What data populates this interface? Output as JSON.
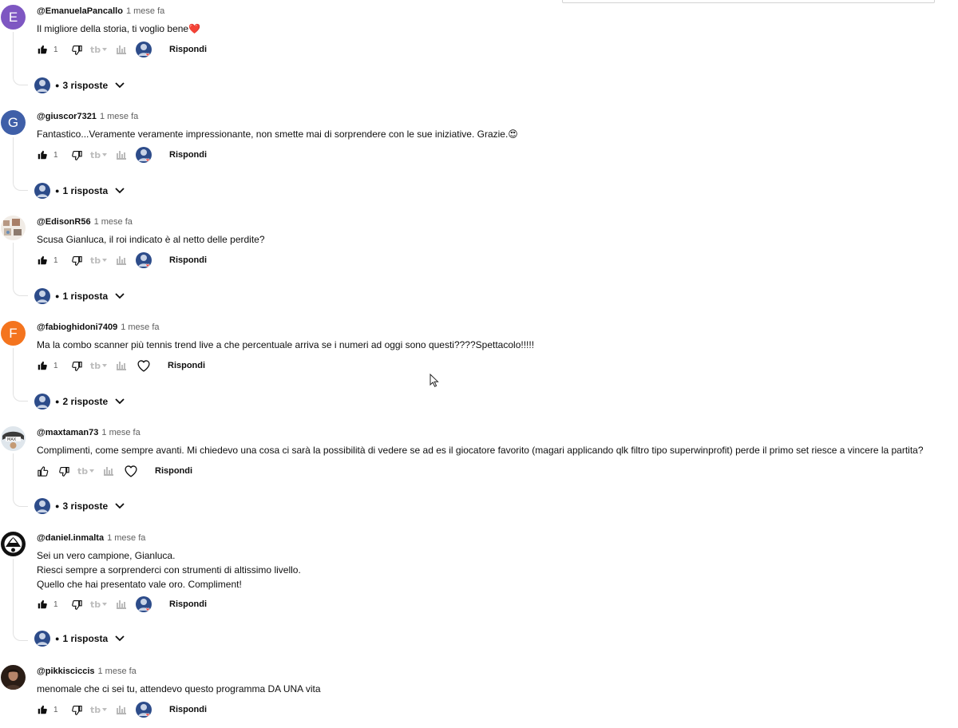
{
  "colors": {
    "avatar_e": "#7e57c2",
    "avatar_g": "#3f5fa8",
    "avatar_f": "#f4741e",
    "reply_link": "#0f0f0f",
    "meta": "#606060"
  },
  "comments": [
    {
      "author": "@EmanuelaPancallo",
      "time": "1 mese fa",
      "avatar_letter": "E",
      "lines": [
        "Il migliore della storia, ti voglio bene❤️"
      ],
      "likes": "1",
      "reply_label": "Rispondi",
      "replies_label": "3 risposte"
    },
    {
      "author": "@giuscor7321",
      "time": "1 mese fa",
      "avatar_letter": "G",
      "lines": [
        "Fantastico...Veramente veramente impressionante, non smette mai di sorprendere con le sue iniziative. Grazie.😍"
      ],
      "likes": "1",
      "reply_label": "Rispondi",
      "replies_label": "1 risposta"
    },
    {
      "author": "@EdisonR56",
      "time": "1 mese fa",
      "lines": [
        "Scusa Gianluca, il roi indicato è al netto delle perdite?"
      ],
      "likes": "1",
      "reply_label": "Rispondi",
      "replies_label": "1 risposta"
    },
    {
      "author": "@fabioghidoni7409",
      "time": "1 mese fa",
      "avatar_letter": "F",
      "lines": [
        "Ma  la combo scanner più tennis trend live a che percentuale arriva se i numeri ad oggi sono questi????Spettacolo!!!!!"
      ],
      "likes": "1",
      "reply_label": "Rispondi",
      "replies_label": "2 risposte"
    },
    {
      "author": "@maxtaman73",
      "time": "1 mese fa",
      "lines": [
        "Complimenti, come sempre avanti. Mi chiedevo una cosa ci sarà la possibilità di vedere se ad es il giocatore favorito (magari applicando qlk filtro tipo  superwinprofit) perde il primo set riesce a vincere la partita?"
      ],
      "likes": "",
      "reply_label": "Rispondi",
      "replies_label": "3 risposte"
    },
    {
      "author": "@daniel.inmalta",
      "time": "1 mese fa",
      "lines": [
        "Sei un vero campione, Gianluca.",
        "Riesci sempre a sorprenderci con strumenti di altissimo livello.",
        "Quello che hai presentato vale oro. Compliment!"
      ],
      "likes": "1",
      "reply_label": "Rispondi",
      "replies_label": "1 risposta"
    },
    {
      "author": "@pikkisciccis",
      "time": "1 mese fa",
      "lines": [
        "menomale che ci sei tu, attendevo questo programma DA UNA vita"
      ],
      "likes": "1",
      "reply_label": "Rispondi"
    }
  ]
}
